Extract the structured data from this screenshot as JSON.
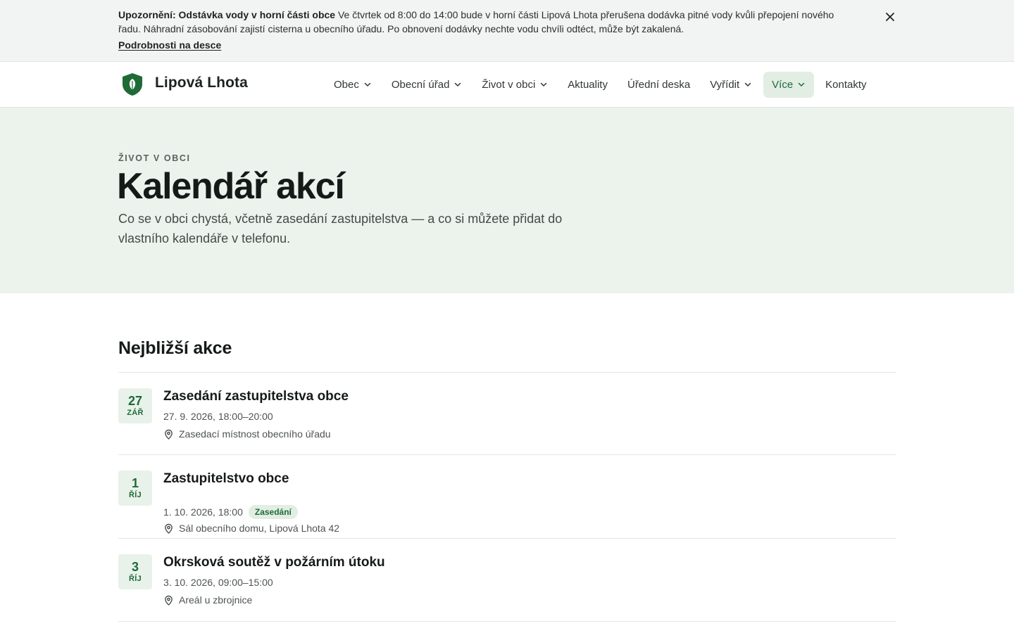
{
  "alert": {
    "heading": "Upozornění: Odstávka vody v horní části obce",
    "text": "Ve čtvrtek od 8:00 do 14:00 bude v horní části Lipová Lhota přerušena dodávka pitné vody kvůli přepojení nového řadu. Náhradní zásobování zajistí cisterna u obecního úřadu. Po obnovení dodávky nechte vodu chvíli odtéct, může být zakalená.",
    "link": "Podrobnosti na desce",
    "close_icon": "close-icon"
  },
  "header": {
    "site_name": "Lipová Lhota",
    "logo_icon": "leaf-shield-icon",
    "nav": [
      {
        "label": "Obec",
        "has_dropdown": true
      },
      {
        "label": "Obecní úřad",
        "has_dropdown": true
      },
      {
        "label": "Život v obci",
        "has_dropdown": true
      },
      {
        "label": "Aktuality",
        "has_dropdown": false
      },
      {
        "label": "Úřední deska",
        "has_dropdown": false
      },
      {
        "label": "Vyřídit",
        "has_dropdown": true
      },
      {
        "label": "Více",
        "has_dropdown": true,
        "active": true
      },
      {
        "label": "Kontakty",
        "has_dropdown": false
      }
    ]
  },
  "hero": {
    "eyebrow": "ŽIVOT V OBCI",
    "title": "Kalendář akcí",
    "lead": "Co se v obci chystá, včetně zasedání zastupitelstva — a co si můžete přidat do vlastního kalendáře v telefonu."
  },
  "events_section": {
    "title": "Nejbližší akce",
    "events": [
      {
        "day": "27",
        "month": "ZÁŘ",
        "title": "Zasedání zastupitelstva obce",
        "time": "27. 9. 2026, 18:00–20:00",
        "tag": "",
        "place": "Zasedací místnost obecního úřadu"
      },
      {
        "day": "1",
        "month": "ŘÍJ",
        "title": "Zastupitelstvo obce",
        "time": "1. 10. 2026, 18:00",
        "tag": "Zasedání",
        "place": "Sál obecního domu, Lipová Lhota 42"
      },
      {
        "day": "3",
        "month": "ŘÍJ",
        "title": "Okrsková soutěž v požárním útoku",
        "time": "3. 10. 2026, 09:00–15:00",
        "tag": "",
        "place": "Areál u zbrojnice"
      }
    ]
  },
  "colors": {
    "accent": "#1f6b37",
    "hero_bg": "#ebf3ec",
    "alert_bg": "#f2f3f3",
    "badge_bg": "#e9f2ea"
  }
}
